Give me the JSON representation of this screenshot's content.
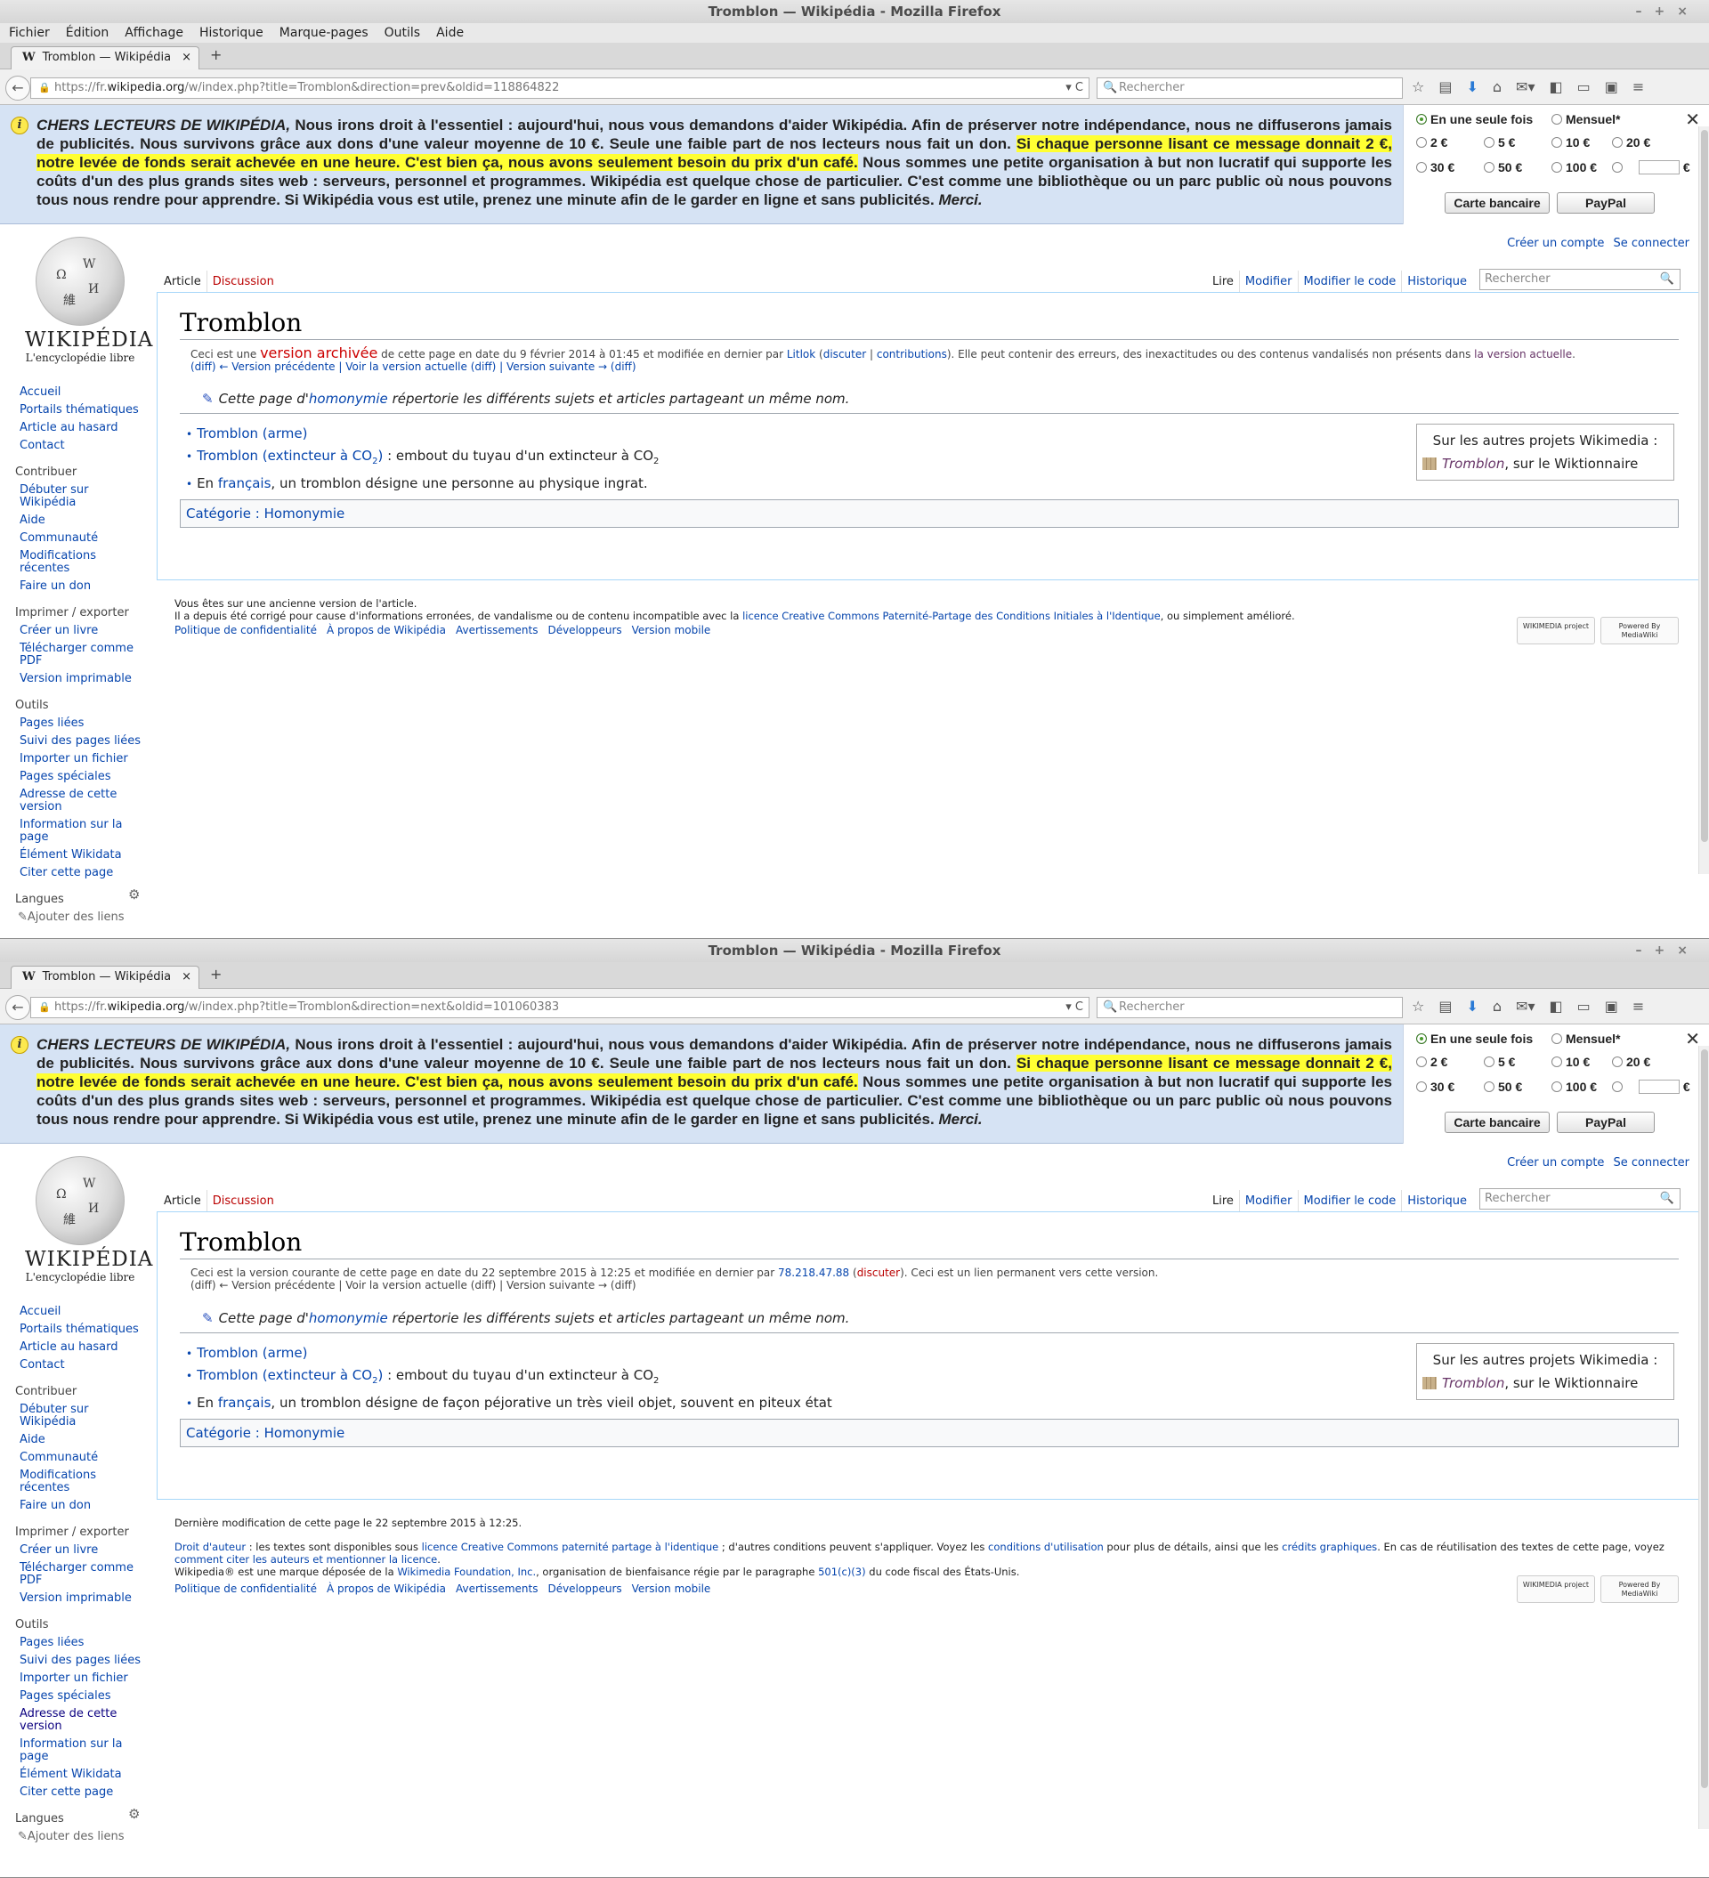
{
  "browser": {
    "title": "Tromblon — Wikipédia - Mozilla Firefox",
    "win_btns": "–+×",
    "menu": [
      "Fichier",
      "Édition",
      "Affichage",
      "Historique",
      "Marque-pages",
      "Outils",
      "Aide"
    ],
    "tab_label": "Tromblon — Wikipédia",
    "tab_fav": "W",
    "tab_close": "×",
    "newtab": "+",
    "search_placeholder": "Rechercher",
    "back": "←",
    "reload": "▾ C",
    "search_icon": "🔍",
    "lock": "🔒",
    "tools": [
      "☆",
      "▤",
      "⬇",
      "⌂",
      "✉▾",
      "◧",
      "▭",
      "▣",
      "≡"
    ]
  },
  "banner": {
    "info": "i",
    "lead": "CHERS LECTEURS DE WIKIPÉDIA,",
    "text1": "Nous irons droit à l'essentiel : aujourd'hui, nous vous demandons d'aider Wikipédia. Afin de préserver notre indépendance, nous ne diffuserons jamais de publicités. Nous survivons grâce aux dons d'une valeur moyenne de 10 €. Seule une faible part de nos lecteurs nous fait un don.",
    "highlight": "Si chaque personne lisant ce message donnait 2 €, notre levée de fonds serait achevée en une heure. C'est bien ça, nous avons seulement besoin du prix d'un café.",
    "text2": "Nous sommes une petite organisation à but non lucratif qui supporte les coûts d'un des plus grands sites web : serveurs, personnel et programmes. Wikipédia est quelque chose de particulier. C'est comme une bibliothèque ou un parc public où nous pouvons tous nous rendre pour apprendre. Si Wikipédia vous est utile, prenez une minute afin de le garder en ligne et sans publicités.",
    "merci": "Merci.",
    "once": "En une seule fois",
    "monthly": "Mensuel*",
    "amounts": [
      "2 €",
      "5 €",
      "10 €",
      "20 €",
      "30 €",
      "50 €",
      "100 €"
    ],
    "euro": "€",
    "card": "Carte bancaire",
    "paypal": "PayPal",
    "close": "✕"
  },
  "wiki": {
    "logo_title": "WIKIPÉDIA",
    "logo_sub": "L'encyclopédie libre",
    "globe": [
      "Ω",
      "W",
      "И",
      "維"
    ],
    "create_account": "Créer un compte",
    "login": "Se connecter",
    "tab_article": "Article",
    "tab_discussion": "Discussion",
    "tab_read": "Lire",
    "tab_edit": "Modifier",
    "tab_edit_source": "Modifier le code",
    "tab_history": "Historique",
    "search_placeholder": "Rechercher",
    "search_icon": "🔍",
    "heading": "Tromblon",
    "homonymie_pre": "Cette page d'",
    "homonymie_link": "homonymie",
    "homonymie_post": " répertorie les différents sujets et articles partageant un même nom.",
    "pen": "✎",
    "item1": "Tromblon (arme)",
    "item2_link": "Tromblon (extincteur à CO",
    "item2_sub": "2",
    "item2_close": ")",
    "item2_text": " : embout du tuyau d'un extincteur à CO",
    "item2_sub2": "2",
    "en": "En ",
    "francais": "français",
    "sister_title": "Sur les autres projets Wikimedia :",
    "sister_link": "Tromblon",
    "sister_text": ", sur le Wiktionnaire",
    "cat_label": "Catégorie : ",
    "cat_value": "Homonymie",
    "nav": [
      "Accueil",
      "Portails thématiques",
      "Article au hasard",
      "Contact"
    ],
    "contribuer": "Contribuer",
    "contrib_items": [
      "Débuter sur Wikipédia",
      "Aide",
      "Communauté",
      "Modifications récentes",
      "Faire un don"
    ],
    "imprimer": "Imprimer / exporter",
    "print_items": [
      "Créer un livre",
      "Télécharger comme PDF",
      "Version imprimable"
    ],
    "outils": "Outils",
    "tool_items": [
      "Pages liées",
      "Suivi des pages liées",
      "Importer un fichier",
      "Pages spéciales",
      "Adresse de cette version",
      "Information sur la page",
      "Élément Wikidata",
      "Citer cette page"
    ],
    "langues": "Langues",
    "gear": "⚙",
    "add_links": "✎Ajouter des liens",
    "footer_links": [
      "Politique de confidentialité",
      "À propos de Wikipédia",
      "Avertissements",
      "Développeurs",
      "Version mobile"
    ],
    "badge1": "WIKIMEDIA project",
    "badge2": "Powered By MediaWiki"
  },
  "w1": {
    "url_pre": "https://fr.",
    "url_host": "wikipedia.org",
    "url_post": "/w/index.php?title=Tromblon&direction=prev&oldid=118864822",
    "n1": "Ceci est une ",
    "n_red": "version archivée",
    "n2": " de cette page en date du 9 février 2014 à 01:45 et modifiée en dernier par ",
    "n_user": "Litlok",
    "n3": " (",
    "n_disc": "discuter",
    "n4": " | ",
    "n_contrib": "contributions",
    "n5": "). Elle peut contenir des erreurs, des inexactitudes ou des contenus vandalisés non présents dans ",
    "n_cur": "la version actuelle",
    "n6": ".",
    "l2": "(diff) ← Version précédente | Voir la version actuelle (diff) | Version suivante → (diff)",
    "item3_text": ", un tromblon désigne une personne au physique ingrat.",
    "foot1": "Vous êtes sur une ancienne version de l'article.",
    "foot2a": "Il a depuis été corrigé pour cause d'informations erronées, de vandalisme ou de contenu incompatible avec la ",
    "foot2_link": "licence Creative Commons Paternité-Partage des Conditions Initiales à l'Identique",
    "foot2b": ", ou simplement amélioré."
  },
  "w2": {
    "url_pre": "https://fr.",
    "url_host": "wikipedia.org",
    "url_post": "/w/index.php?title=Tromblon&direction=next&oldid=101060383",
    "n1": "Ceci est la version courante de cette page en date du 22 septembre 2015 à 12:25 et modifiée en dernier par ",
    "n_user": "78.218.47.88",
    "n3": " (",
    "n_disc": "discuter",
    "n5": "). Ceci est un lien permanent vers cette version.",
    "l2": "(diff) ← Version précédente | Voir la version actuelle (diff) | Version suivante → (diff)",
    "item3_text": ", un tromblon désigne de façon péjorative un très vieil objet, souvent en piteux état",
    "foot1": "Dernière modification de cette page le 22 septembre 2015 à 12:25.",
    "foot2_droit": "Droit d'auteur",
    "foot2a": " : les textes sont disponibles sous ",
    "foot2_lic": "licence Creative Commons paternité partage à l'identique",
    "foot2b": " ; d'autres conditions peuvent s'appliquer. Voyez les ",
    "foot2_cond": "conditions d'utilisation",
    "foot2c": " pour plus de détails, ainsi que les ",
    "foot2_cred": "crédits graphiques",
    "foot2d": ". En cas de réutilisation des textes de cette page, voyez ",
    "foot2_cite": "comment citer les auteurs et mentionner la licence",
    "foot2e": ".",
    "foot3a": "Wikipedia® est une marque déposée de la ",
    "foot3_wf": "Wikimedia Foundation, Inc.",
    "foot3b": ", organisation de bienfaisance régie par le paragraphe ",
    "foot3_501": "501(c)(3)",
    "foot3c": " du code fiscal des États-Unis."
  }
}
